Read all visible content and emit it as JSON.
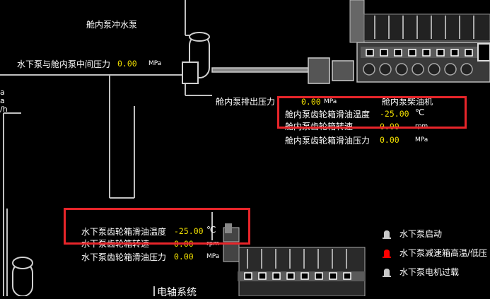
{
  "colors": {
    "background": "#000000",
    "value": "#f2e000",
    "highlight_box": "#e8252a",
    "alarm_on": "#ff0000",
    "alarm_off": "#c8c8c8",
    "pipe": "#c0c0c0"
  },
  "labels": {
    "cabin_pump_water": "舱内泵冲水泵",
    "mid_pressure": "水下泵与舱内泵中间压力",
    "discharge_pressure": "舱内泵排出压力",
    "cabin_engine": "舱内泵柴油机",
    "cabin_gearbox_temp": "舱内泵齿轮箱滑油温度",
    "cabin_gearbox_speed": "舱内泵齿轮箱转速",
    "cabin_gearbox_pressure": "舱内泵齿轮箱滑油压力",
    "uw_gearbox_temp": "水下泵齿轮箱滑油温度",
    "uw_gearbox_speed": "水下泵齿轮箱转速",
    "uw_gearbox_pressure": "水下泵齿轮箱滑油压力",
    "shaft_system": "电轴系统",
    "left_a1": "a",
    "left_a2": "a",
    "left_h": "/h"
  },
  "values": {
    "mid_pressure": "0.00",
    "discharge_pressure": "0.00",
    "cabin_gearbox_temp": "-25.00",
    "cabin_gearbox_speed": "0.00",
    "cabin_gearbox_pressure": "0.00",
    "uw_gearbox_temp": "-25.00",
    "uw_gearbox_speed": "0.00",
    "uw_gearbox_pressure": "0.00"
  },
  "units": {
    "mpa": "MPa",
    "celsius": "℃",
    "rpm": "rpm"
  },
  "legend": [
    {
      "label": "水下泵启动",
      "state": "off",
      "icon": "bell-icon"
    },
    {
      "label": "水下泵减速箱高温/低压",
      "state": "on",
      "icon": "bell-icon"
    },
    {
      "label": "水下泵电机过载",
      "state": "off",
      "icon": "bell-icon"
    }
  ]
}
